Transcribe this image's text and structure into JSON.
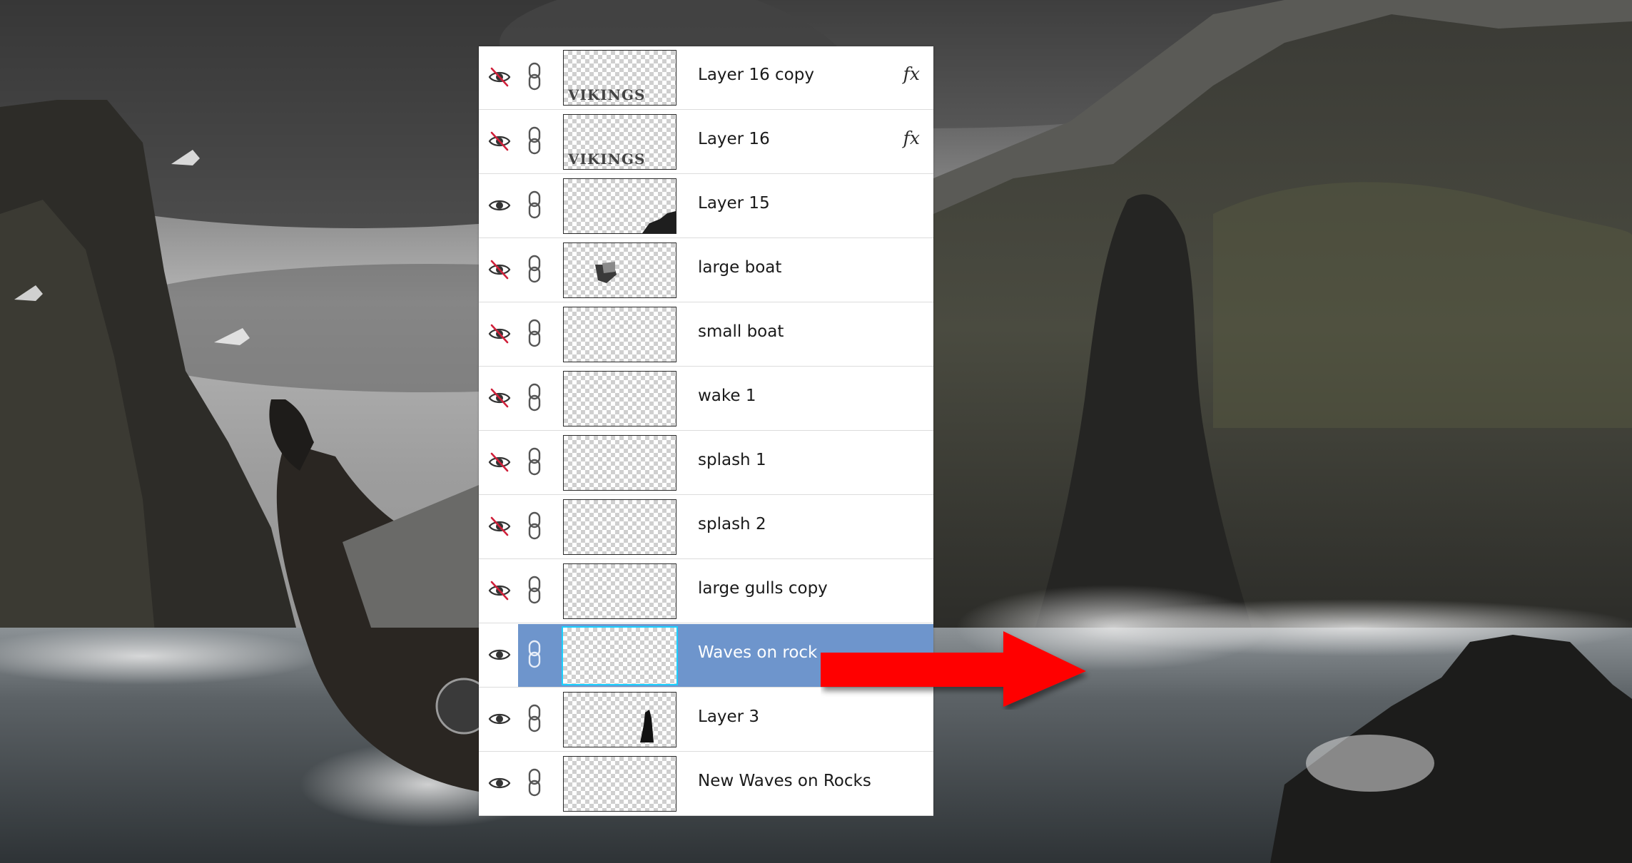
{
  "colors": {
    "panel_bg": "#ffffff",
    "selected_row": "#6e95cc",
    "selected_thumb_border": "#1bd0ff",
    "hidden_slash": "#d0203a",
    "arrow": "#ff0000"
  },
  "layers": [
    {
      "name": "Layer 16 copy",
      "visible": false,
      "fx": "fx",
      "thumb_text": "VIKINGS",
      "thumb_content": "title-text"
    },
    {
      "name": "Layer 16",
      "visible": false,
      "fx": "fx",
      "thumb_text": "VIKINGS",
      "thumb_content": "title-text"
    },
    {
      "name": "Layer 15",
      "visible": true,
      "fx": "",
      "thumb_text": "",
      "thumb_content": "rock-corner"
    },
    {
      "name": "large boat",
      "visible": false,
      "fx": "",
      "thumb_text": "",
      "thumb_content": "boat"
    },
    {
      "name": "small boat",
      "visible": false,
      "fx": "",
      "thumb_text": "",
      "thumb_content": "empty"
    },
    {
      "name": "wake 1",
      "visible": false,
      "fx": "",
      "thumb_text": "",
      "thumb_content": "empty"
    },
    {
      "name": "splash 1",
      "visible": false,
      "fx": "",
      "thumb_text": "",
      "thumb_content": "empty"
    },
    {
      "name": "splash 2",
      "visible": false,
      "fx": "",
      "thumb_text": "",
      "thumb_content": "empty"
    },
    {
      "name": "large gulls copy",
      "visible": false,
      "fx": "",
      "thumb_text": "",
      "thumb_content": "empty"
    },
    {
      "name": "Waves on rock",
      "visible": true,
      "fx": "",
      "thumb_text": "",
      "thumb_content": "empty",
      "selected": true
    },
    {
      "name": "Layer 3",
      "visible": true,
      "fx": "",
      "thumb_text": "",
      "thumb_content": "rock-spire"
    },
    {
      "name": "New Waves on Rocks",
      "visible": true,
      "fx": "",
      "thumb_text": "",
      "thumb_content": "empty"
    }
  ],
  "icons": {
    "visible": "eye-icon",
    "hidden": "eye-hidden-icon",
    "link": "chain-link-icon",
    "annotation": "red-arrow-icon"
  }
}
